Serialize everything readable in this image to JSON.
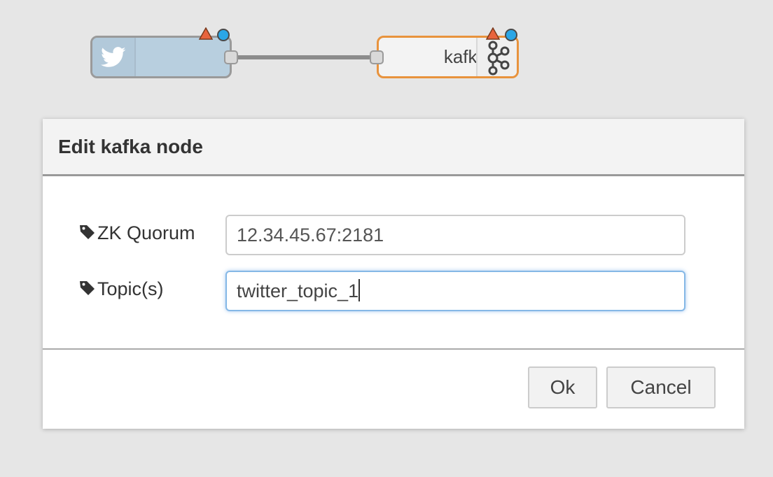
{
  "flow": {
    "twitter_node": {
      "icon": "twitter-icon",
      "label": ""
    },
    "kafka_node": {
      "label": "kafka",
      "icon": "kafka-icon",
      "border_color": "#e8933d"
    },
    "colors": {
      "warning": "#e8643d",
      "status_dot": "#2aa6e6",
      "wire": "#8c8c8c"
    }
  },
  "dialog": {
    "title": "Edit kafka node",
    "fields": [
      {
        "label": "ZK Quorum",
        "icon": "tag-icon",
        "value": "12.34.45.67:2181",
        "focused": false
      },
      {
        "label": "Topic(s)",
        "icon": "tag-icon",
        "value": "twitter_topic_1",
        "focused": true
      }
    ],
    "buttons": {
      "ok": "Ok",
      "cancel": "Cancel"
    }
  }
}
